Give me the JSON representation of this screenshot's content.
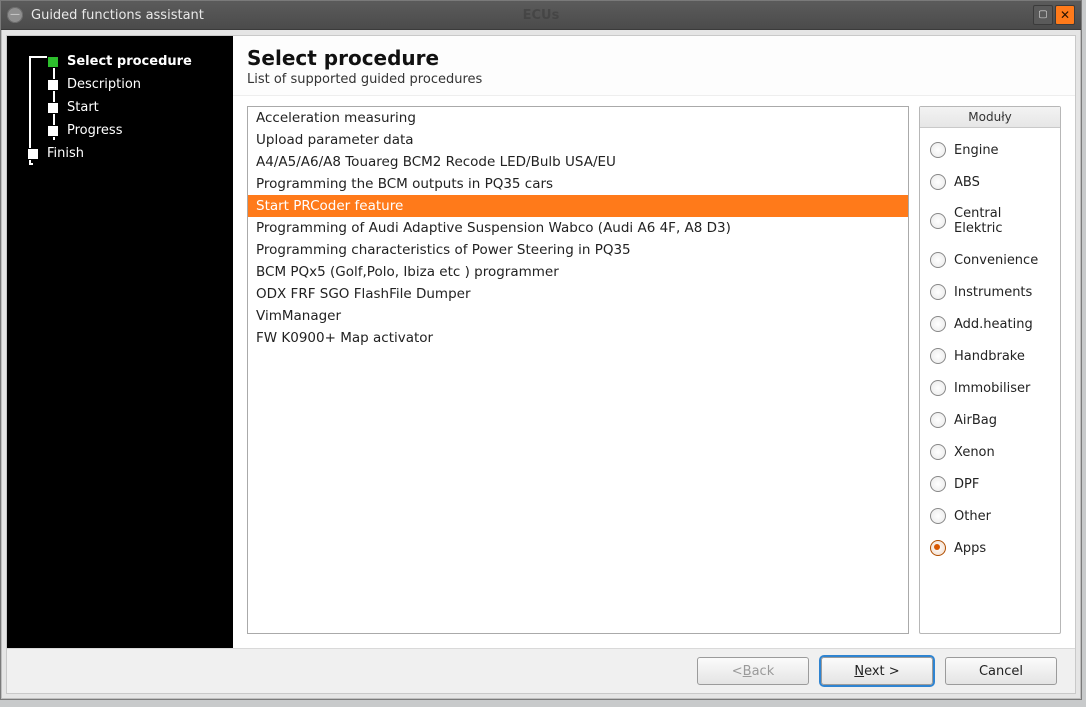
{
  "window": {
    "title": "Guided functions assistant",
    "background_hint": "ECUs"
  },
  "steps": [
    {
      "id": "select",
      "label": "Select procedure",
      "current": true,
      "indent": "inner"
    },
    {
      "id": "description",
      "label": "Description",
      "current": false,
      "indent": "inner"
    },
    {
      "id": "start",
      "label": "Start",
      "current": false,
      "indent": "inner"
    },
    {
      "id": "progress",
      "label": "Progress",
      "current": false,
      "indent": "inner"
    },
    {
      "id": "finish",
      "label": "Finish",
      "current": false,
      "indent": "outer"
    }
  ],
  "header": {
    "title": "Select procedure",
    "subtitle": "List of supported guided procedures"
  },
  "procedures": [
    {
      "label": "Acceleration measuring",
      "selected": false
    },
    {
      "label": "Upload parameter data",
      "selected": false
    },
    {
      "label": "A4/A5/A6/A8 Touareg BCM2 Recode LED/Bulb USA/EU",
      "selected": false
    },
    {
      "label": "Programming the BCM outputs in PQ35 cars",
      "selected": false
    },
    {
      "label": "Start PRCoder feature",
      "selected": true
    },
    {
      "label": "Programming of Audi Adaptive Suspension Wabco (Audi A6 4F, A8 D3)",
      "selected": false
    },
    {
      "label": "Programming characteristics of Power Steering in PQ35",
      "selected": false
    },
    {
      "label": "BCM PQx5 (Golf,Polo, Ibiza etc ) programmer",
      "selected": false
    },
    {
      "label": "ODX FRF SGO FlashFile Dumper",
      "selected": false
    },
    {
      "label": "VimManager",
      "selected": false
    },
    {
      "label": "FW K0900+ Map activator",
      "selected": false
    }
  ],
  "modules_legend": "Moduły",
  "modules": [
    {
      "label": "Engine",
      "selected": false
    },
    {
      "label": "ABS",
      "selected": false
    },
    {
      "label": "Central Elektric",
      "selected": false
    },
    {
      "label": "Convenience",
      "selected": false
    },
    {
      "label": "Instruments",
      "selected": false
    },
    {
      "label": "Add.heating",
      "selected": false
    },
    {
      "label": "Handbrake",
      "selected": false
    },
    {
      "label": "Immobiliser",
      "selected": false
    },
    {
      "label": "AirBag",
      "selected": false
    },
    {
      "label": "Xenon",
      "selected": false
    },
    {
      "label": "DPF",
      "selected": false
    },
    {
      "label": "Other",
      "selected": false
    },
    {
      "label": "Apps",
      "selected": true
    }
  ],
  "buttons": {
    "back": {
      "pre": "< ",
      "ul": "B",
      "post": "ack"
    },
    "next": {
      "pre": "",
      "ul": "N",
      "post": "ext >"
    },
    "cancel": {
      "pre": "",
      "ul": "",
      "post": "Cancel"
    }
  }
}
